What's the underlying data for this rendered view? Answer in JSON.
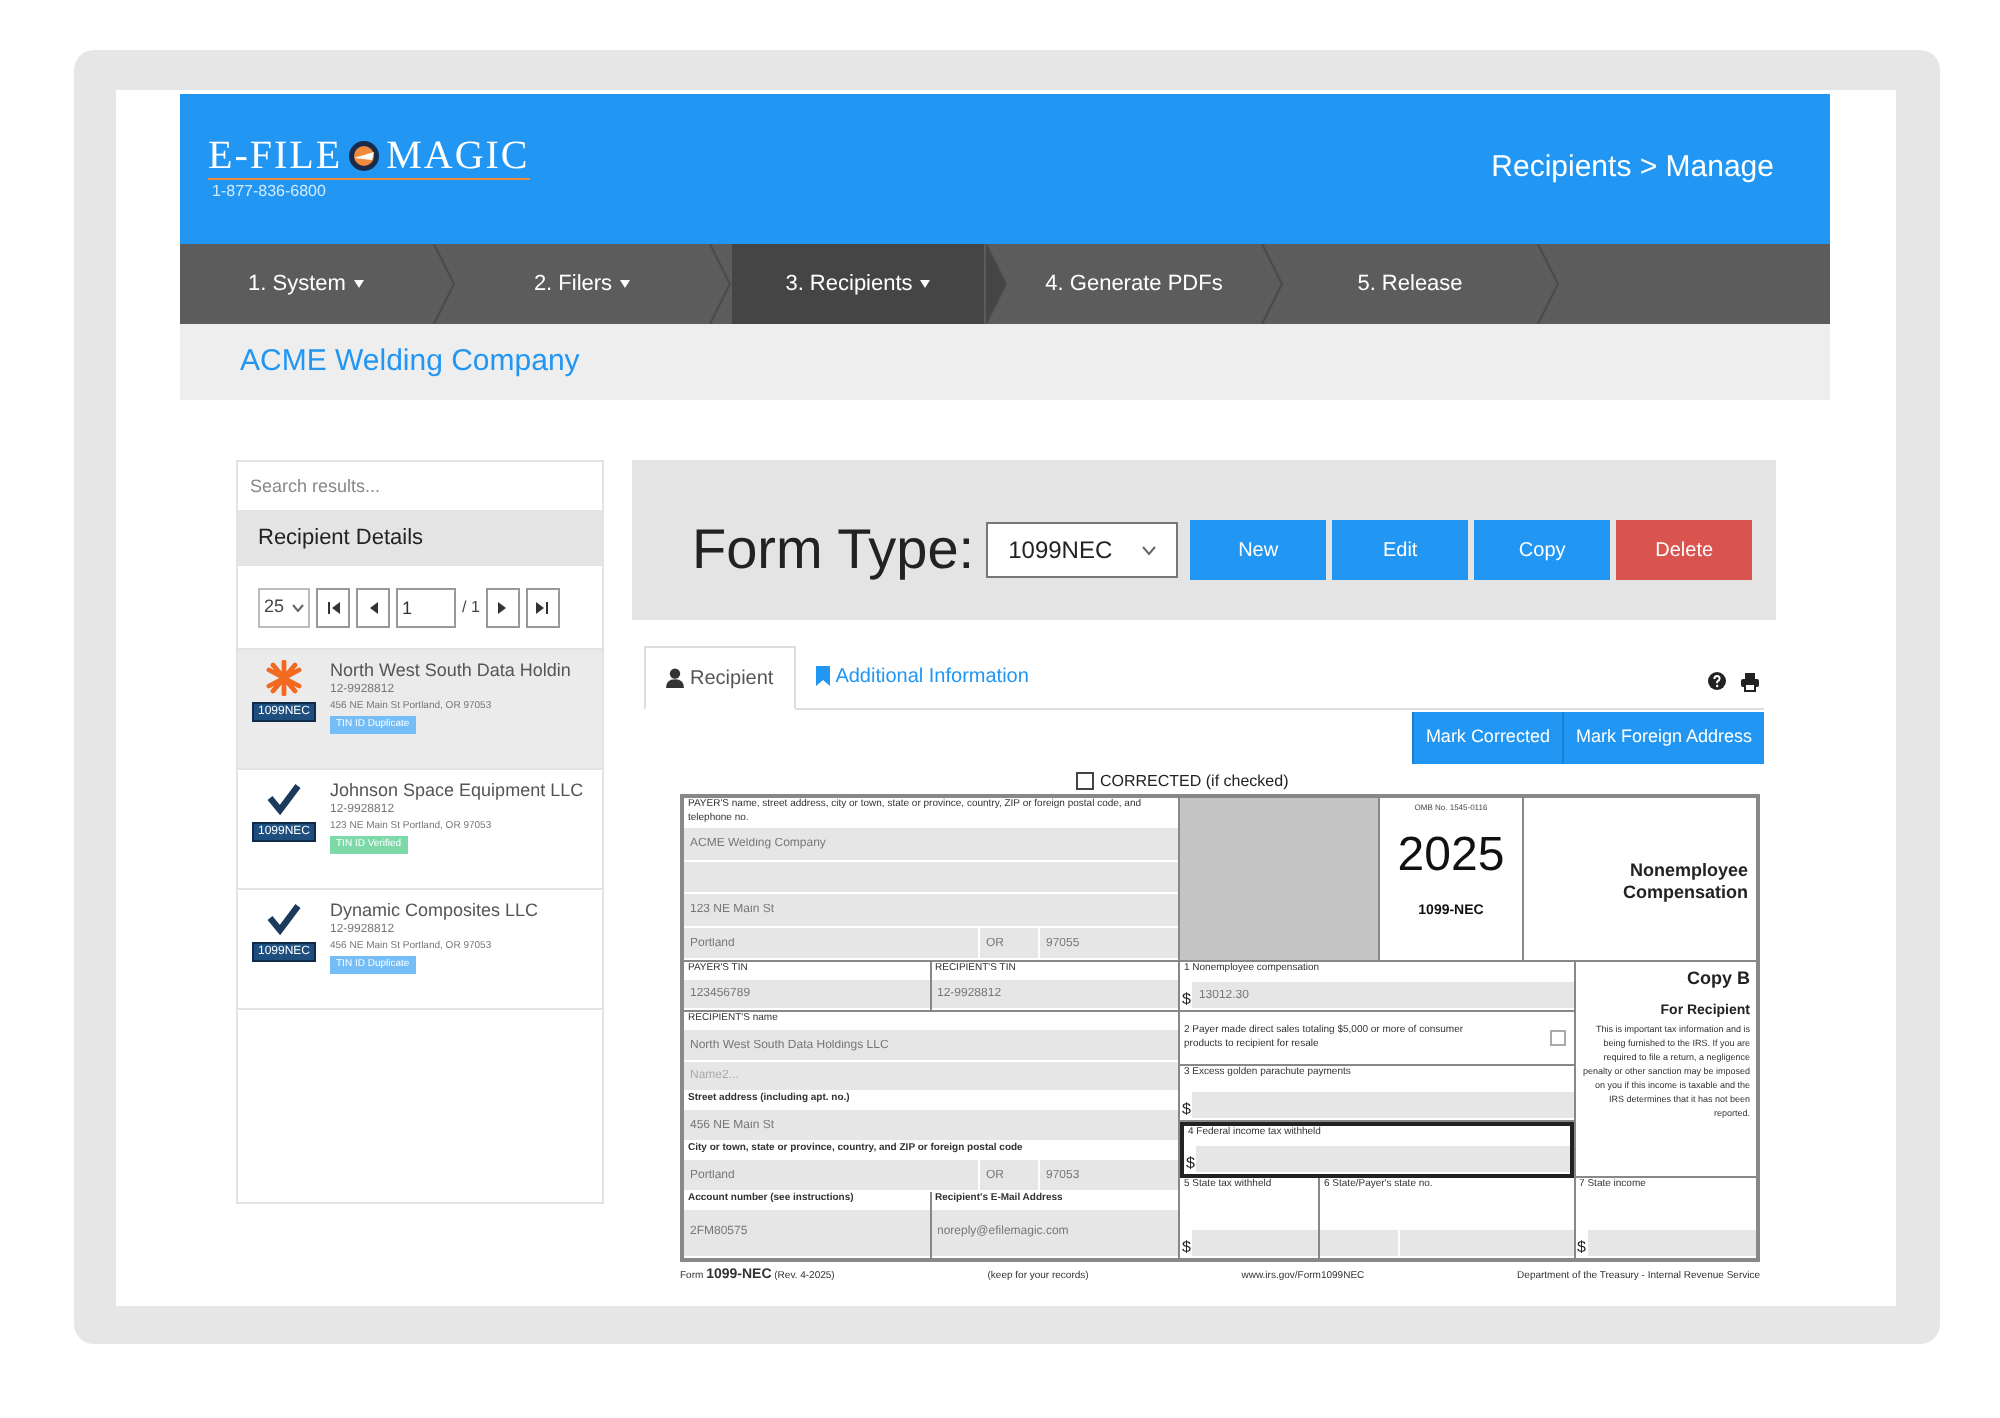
{
  "logo": {
    "left": "E-FILE",
    "right": "MAGIC",
    "phone": "1-877-836-6800"
  },
  "breadcrumb": "Recipients > Manage",
  "steps": [
    {
      "label": "1. System",
      "dropdown": true,
      "selected": false
    },
    {
      "label": "2. Filers",
      "dropdown": true,
      "selected": false
    },
    {
      "label": "3. Recipients",
      "dropdown": true,
      "selected": true
    },
    {
      "label": "4. Generate PDFs",
      "dropdown": false,
      "selected": false
    },
    {
      "label": "5. Release",
      "dropdown": false,
      "selected": false
    }
  ],
  "company": "ACME Welding Company",
  "recipients_panel": {
    "search_placeholder": "Search results...",
    "title": "Recipient Details",
    "page_size": "25",
    "page": "1",
    "page_count": "/ 1",
    "items": [
      {
        "name": "North West South Data Holdin",
        "tin": "12-9928812",
        "address": "456 NE Main St Portland, OR 97053",
        "form": "1099NEC",
        "badge": "TIN ID Duplicate",
        "color": "#74bdf7",
        "kind": "alert",
        "selected": true
      },
      {
        "name": "Johnson Space Equipment LLC",
        "tin": "12-9928812",
        "address": "123 NE Main St Portland, OR 97053",
        "form": "1099NEC",
        "badge": "TIN ID Verified",
        "color": "#7ddaa8",
        "kind": "done",
        "selected": false
      },
      {
        "name": "Dynamic Composites LLC",
        "tin": "12-9928812",
        "address": "456 NE Main St Portland, OR 97053",
        "form": "1099NEC",
        "badge": "TIN ID Duplicate",
        "color": "#74bdf7",
        "kind": "done",
        "selected": false
      }
    ]
  },
  "form_header": {
    "label": "Form Type:",
    "form_type": "1099NEC",
    "buttons": [
      {
        "label": "New",
        "kind": "primary"
      },
      {
        "label": "Edit",
        "kind": "primary"
      },
      {
        "label": "Copy",
        "kind": "primary"
      },
      {
        "label": "Delete",
        "kind": "danger"
      }
    ]
  },
  "tabs": [
    {
      "label": "Recipient",
      "selected": true
    },
    {
      "label": "Additional Information",
      "selected": false
    }
  ],
  "actions": [
    "Mark Corrected",
    "Mark Foreign Address"
  ],
  "corrected": {
    "label": "CORRECTED (if checked)",
    "checked": false
  },
  "form": {
    "payer_label": "PAYER'S name, street address, city or town, state or province, country, ZIP or foreign postal code, and telephone no.",
    "payer_name": "ACME Welding Company",
    "payer_street": "123 NE Main St",
    "payer_city": "Portland",
    "payer_state": "OR",
    "payer_zip": "97055",
    "payer_tin_label": "PAYER'S TIN",
    "payer_tin": "123456789",
    "recipient_tin_label": "RECIPIENT'S TIN",
    "recipient_tin": "12-9928812",
    "recipient_name_label": "RECIPIENT'S name",
    "recipient_name": "North West South Data Holdings LLC",
    "name2_placeholder": "Name2...",
    "street_label": "Street address (including apt. no.)",
    "street": "456 NE Main St",
    "city_label": "City or town, state or province, country, and ZIP or foreign postal code",
    "city": "Portland",
    "state": "OR",
    "zip": "97053",
    "account_label": "Account number (see instructions)",
    "account": "2FM80575",
    "email_label": "Recipient's E-Mail Address",
    "email": "noreply@efilemagic.com",
    "omb": "OMB No. 1545-0116",
    "year": "2025",
    "form_name": "1099-NEC",
    "title": "Nonemployee Compensation",
    "copy": "Copy B",
    "copy_for": "For Recipient",
    "notice": "This is important tax information and is being furnished to the IRS. If you are required to file a return, a negligence penalty or other sanction may be imposed on you if this income is taxable and the IRS determines that it has not been reported.",
    "boxes": [
      {
        "kind": "amount",
        "label": "1 Nonemployee compensation",
        "currency": "$",
        "value": "13012.30",
        "focused": false
      },
      {
        "kind": "checkbox",
        "label": "2 Payer made direct sales totaling $5,000 or more of consumer products to recipient for resale",
        "checked": false,
        "focused": false
      },
      {
        "kind": "amount",
        "label": "3 Excess golden parachute payments",
        "currency": "$",
        "focused": false
      },
      {
        "kind": "amount",
        "label": "4 Federal income tax withheld",
        "currency": "$",
        "focused": true
      }
    ],
    "state_boxes": {
      "tax_label": "5 State tax withheld",
      "tax_currency": "$",
      "no_label": "6 State/Payer's state no.",
      "income_label": "7 State income",
      "income_currency": "$"
    },
    "footer": {
      "form": "Form **1099-NEC** (Rev. 4-2025)",
      "keep": "(keep for your records)",
      "url": "www.irs.gov/Form1099NEC",
      "dept": "Department of the Treasury - Internal Revenue Service"
    }
  }
}
